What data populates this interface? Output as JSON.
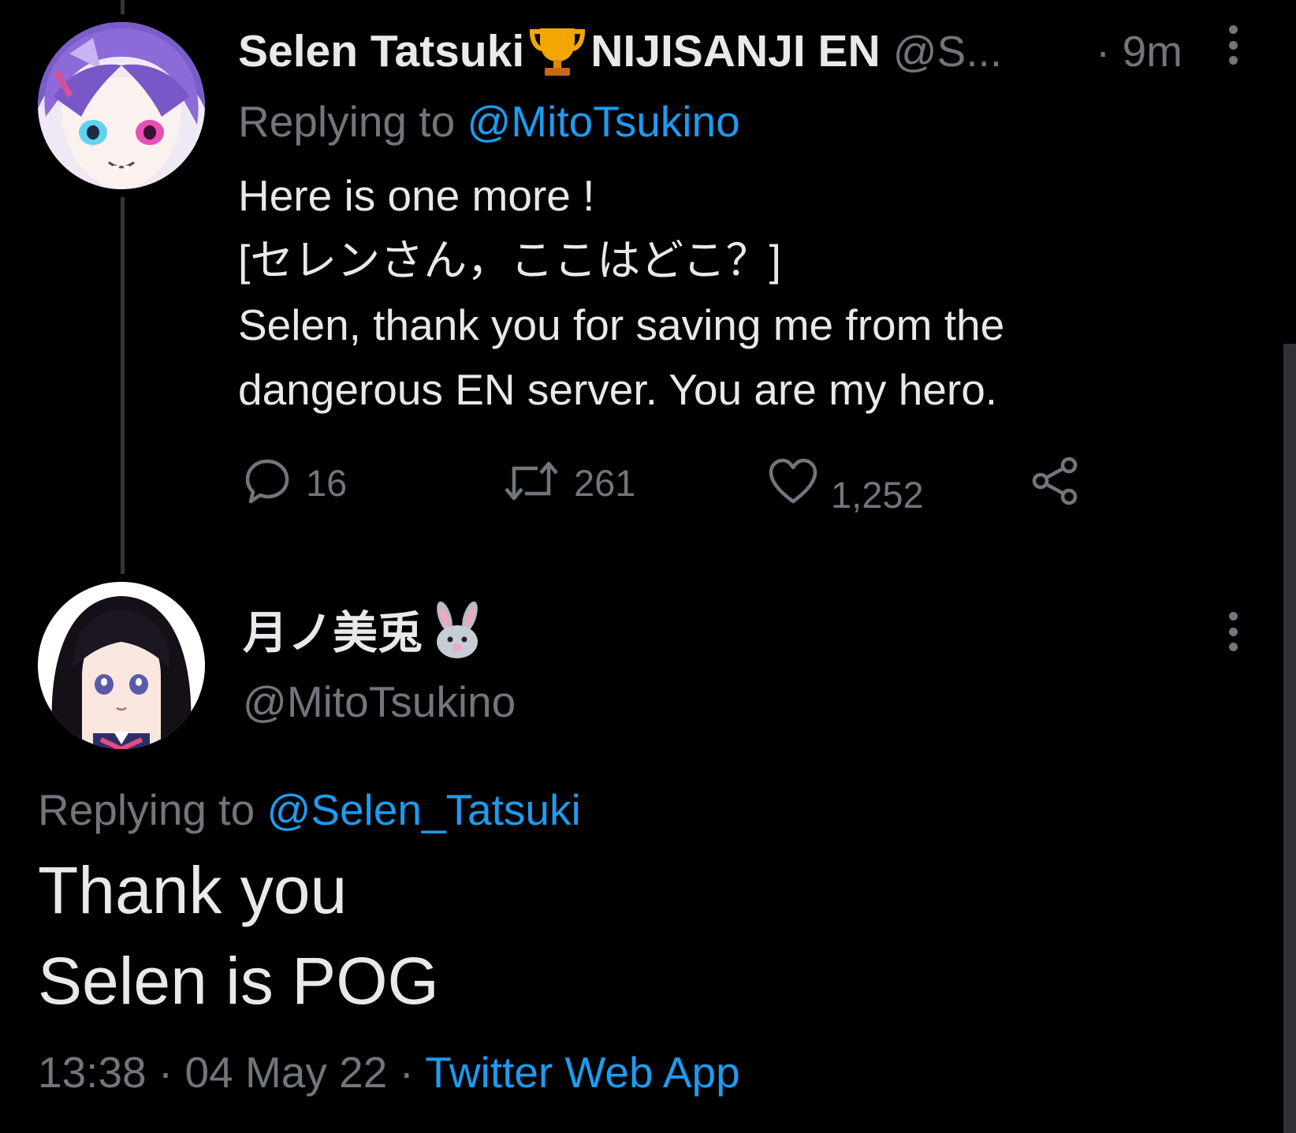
{
  "colors": {
    "background": "#000000",
    "text_primary": "#e7e9ea",
    "text_secondary": "#71767b",
    "accent": "#1d9bf0"
  },
  "tweet1": {
    "display_name": "Selen Tatsuki",
    "badge_icon": "trophy-icon",
    "name_suffix": "NIJISANJI EN",
    "handle": "@S...",
    "time": "· 9m",
    "replying_prefix": "Replying to",
    "replying_to": "@MitoTsukino",
    "body_lines": [
      "Here is one more !",
      "[セレンさん，ここはどこ？]",
      "Selen, thank you for saving me from the",
      "dangerous EN server. You are my hero."
    ],
    "actions": {
      "replies": "16",
      "retweets": "261",
      "likes": "1,252"
    }
  },
  "tweet2": {
    "display_name": "月ノ美兎",
    "name_emoji": "🐰",
    "handle": "@MitoTsukino",
    "replying_prefix": "Replying to",
    "replying_to": "@Selen_Tatsuki",
    "body_lines": [
      "Thank you",
      "Selen is POG"
    ],
    "time": "13:38",
    "date": "04 May 22",
    "separator": "·",
    "source": "Twitter Web App"
  }
}
